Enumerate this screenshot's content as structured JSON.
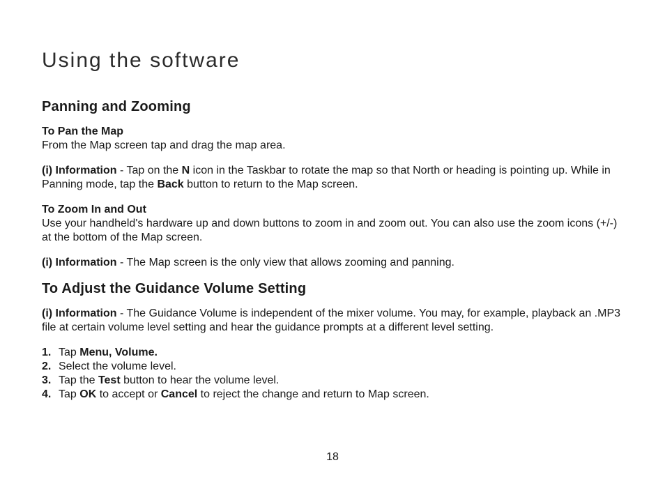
{
  "title": "Using the software",
  "section1": {
    "heading": "Panning and Zooming",
    "pan": {
      "heading": "To Pan the Map",
      "body": "From the Map screen tap and drag the map area."
    },
    "info1": {
      "label": "(i) Information",
      "dash": " - Tap on the ",
      "n_bold": "N",
      "mid": " icon in the Taskbar to rotate the map so that North or heading is pointing up. While in Panning mode, tap the ",
      "back_bold": "Back",
      "tail": " button to return to the Map screen."
    },
    "zoom": {
      "heading": "To Zoom In and Out",
      "body": "Use your handheld's hardware up and down buttons to zoom in and zoom out. You can also use the zoom icons (+/-) at the bottom of the Map screen."
    },
    "info2": {
      "label": "(i) Information",
      "tail": " - The Map screen is the only view that allows zooming and panning."
    }
  },
  "section2": {
    "heading": "To Adjust the Guidance Volume Setting",
    "info": {
      "label": "(i) Information",
      "tail": " - The Guidance Volume is independent of the mixer volume. You may, for example, playback an .MP3 file at certain volume level setting and hear the guidance prompts at a different level setting."
    },
    "steps": {
      "s1": {
        "num": "1.",
        "pre": "Tap ",
        "bold": "Menu, Volume."
      },
      "s2": {
        "num": "2.",
        "text": "Select the volume level."
      },
      "s3": {
        "num": "3.",
        "pre": "Tap the ",
        "bold": "Test",
        "post": " button to hear the volume level."
      },
      "s4": {
        "num": "4.",
        "pre": "Tap ",
        "bold1": "OK",
        "mid": " to accept or ",
        "bold2": "Cancel",
        "post": " to reject the change and return to Map screen."
      }
    }
  },
  "page_number": "18"
}
